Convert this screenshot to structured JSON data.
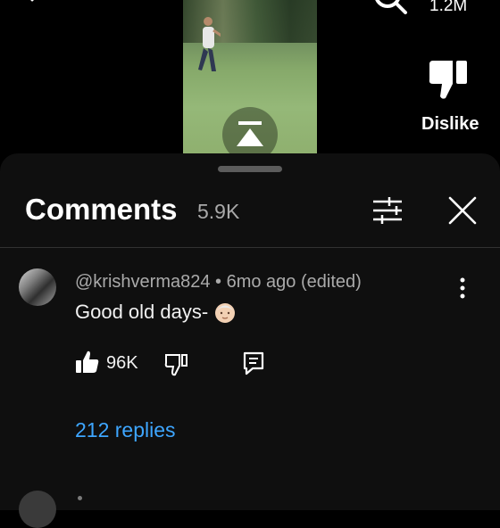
{
  "header": {
    "view_count": "1.2M",
    "dislike_label": "Dislike"
  },
  "comments_panel": {
    "title": "Comments",
    "count": "5.9K"
  },
  "comment": {
    "author": "@krishverma824",
    "separator": " • ",
    "time": "6mo ago (edited)",
    "text": "Good old days-",
    "emoji": "older-man-emoji",
    "like_count": "96K",
    "replies_label": "212 replies"
  },
  "icons": {
    "back": "chevron-icon",
    "search": "search-icon",
    "dislike": "thumbs-down-icon",
    "filter": "sliders-icon",
    "close": "close-icon",
    "more": "vertical-dots-icon",
    "like": "thumbs-up-icon",
    "reply": "comment-reply-icon",
    "overlay": "upload-arrow-icon"
  },
  "colors": {
    "background": "#000000",
    "sheet": "#0f0f0f",
    "link": "#3ea6ff",
    "secondary_text": "#aaaaaa"
  }
}
